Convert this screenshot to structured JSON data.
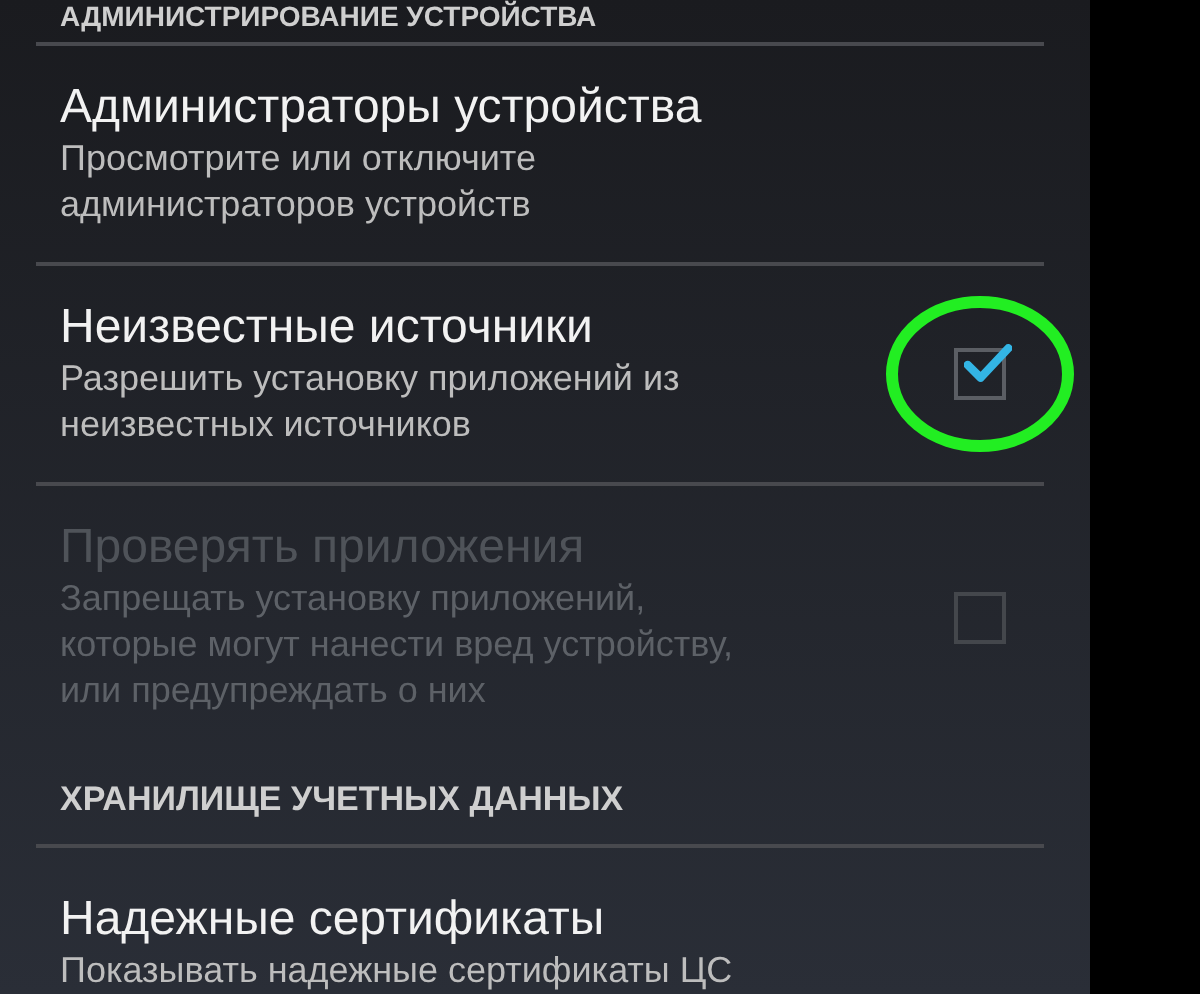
{
  "sections": [
    {
      "kind": "header",
      "title": "АДМИНИСТРИРОВАНИЕ УСТРОЙСТВА"
    },
    {
      "kind": "setting",
      "title": "Администраторы устройства",
      "summary": "Просмотрите или отключите администраторов устройств",
      "disabled": false
    },
    {
      "kind": "setting",
      "title": "Неизвестные источники",
      "summary": "Разрешить установку приложений из неизвестных источников",
      "disabled": false,
      "checkbox": {
        "checked": true,
        "highlighted": true
      }
    },
    {
      "kind": "setting",
      "title": "Проверять приложения",
      "summary": "Запрещать установку приложений, которые могут нанести вред устройству, или предупреждать о них",
      "disabled": true,
      "checkbox": {
        "checked": false
      }
    },
    {
      "kind": "header",
      "title": "ХРАНИЛИЩЕ УЧЕТНЫХ ДАННЫХ"
    },
    {
      "kind": "setting",
      "title": "Надежные сертификаты",
      "summary": "Показывать надежные сертификаты ЦС",
      "disabled": false
    }
  ]
}
